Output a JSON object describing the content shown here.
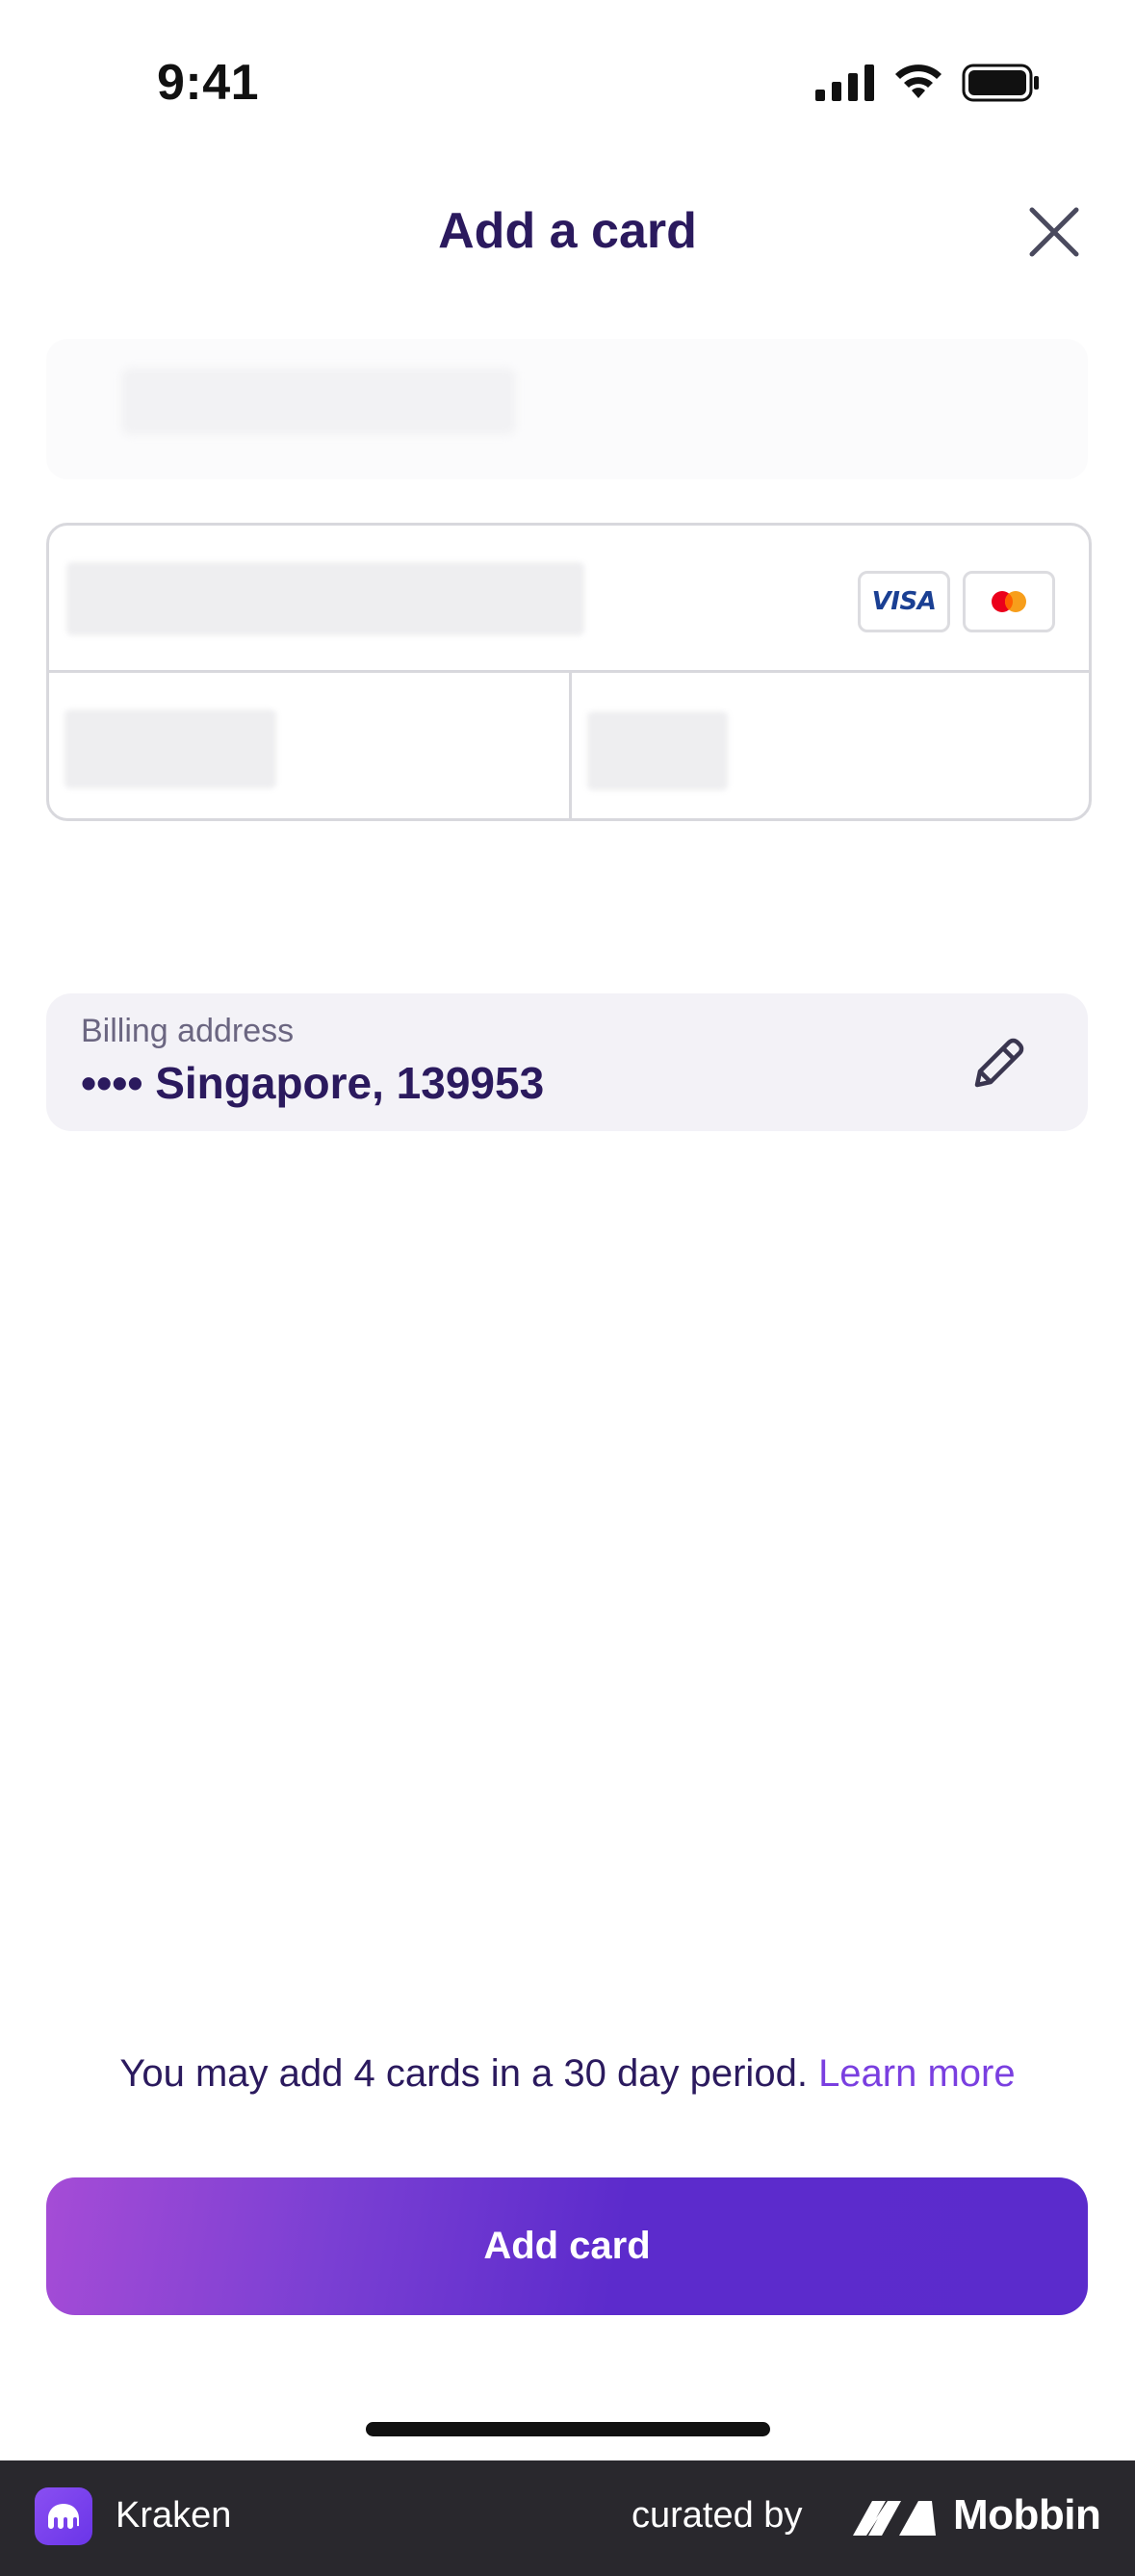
{
  "status_bar": {
    "time": "9:41",
    "icons": [
      "signal-icon",
      "wifi-icon",
      "battery-icon"
    ]
  },
  "header": {
    "title": "Add a card",
    "close_icon": "close-icon"
  },
  "card_form": {
    "brands": {
      "visa_label": "VISA",
      "mastercard_icon": "mastercard-icon"
    }
  },
  "billing": {
    "label": "Billing address",
    "value": "•••• Singapore, 139953",
    "edit_icon": "pencil-icon"
  },
  "notice": {
    "text": "You may add 4 cards in a 30 day period.",
    "link": "Learn more"
  },
  "actions": {
    "add_card_label": "Add card"
  },
  "footer": {
    "app_name": "Kraken",
    "curated_by": "curated by",
    "brand": "Mobbin"
  },
  "colors": {
    "title": "#2b1a5e",
    "link": "#7a3fe0",
    "button_start": "#a54cd6",
    "button_end": "#5b2bcc",
    "billing_bg": "#f3f2f7",
    "footer_bg": "#29282d"
  }
}
